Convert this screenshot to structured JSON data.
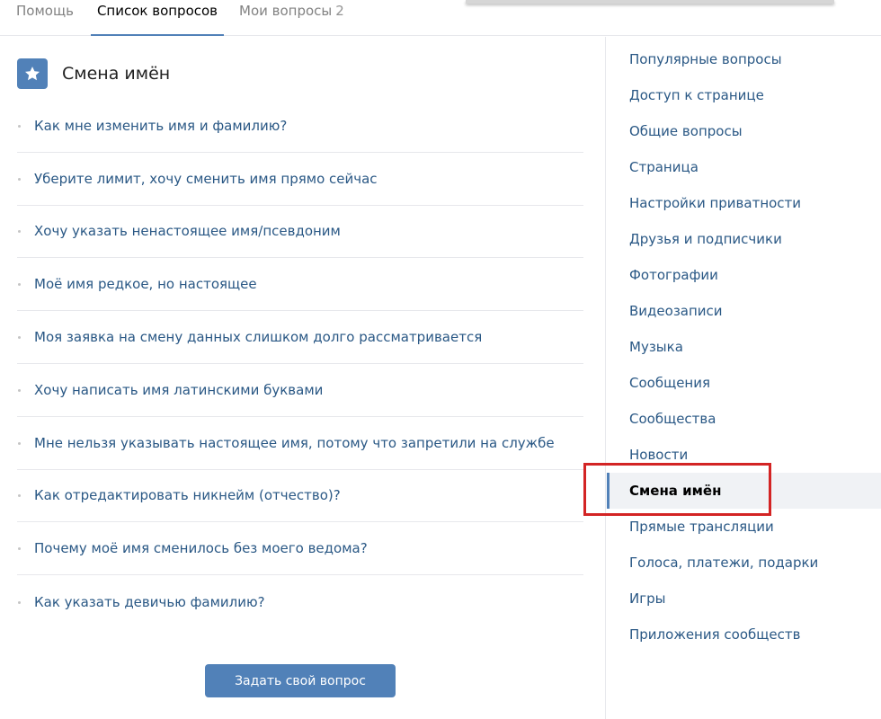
{
  "tabs": {
    "help": "Помощь",
    "questions_list": "Список вопросов",
    "my_questions": "Мои вопросы",
    "my_questions_count": "2"
  },
  "section": {
    "icon": "star-icon",
    "title": "Смена имён"
  },
  "questions": [
    "Как мне изменить имя и фамилию?",
    "Уберите лимит, хочу сменить имя прямо сейчас",
    "Хочу указать ненастоящее имя/псевдоним",
    "Моё имя редкое, но настоящее",
    "Моя заявка на смену данных слишком долго рассматривается",
    "Хочу написать имя латинскими буквами",
    "Мне нельзя указывать настоящее имя, потому что запретили на службе",
    "Как отредактировать никнейм (отчество)?",
    "Почему моё имя сменилось без моего ведома?",
    "Как указать девичью фамилию?"
  ],
  "ask_button": "Задать свой вопрос",
  "sidebar": {
    "items": [
      "Популярные вопросы",
      "Доступ к странице",
      "Общие вопросы",
      "Страница",
      "Настройки приватности",
      "Друзья и подписчики",
      "Фотографии",
      "Видеозаписи",
      "Музыка",
      "Сообщения",
      "Сообщества",
      "Новости",
      "Смена имён",
      "Прямые трансляции",
      "Голоса, платежи, подарки",
      "Игры",
      "Приложения сообществ"
    ],
    "active_index": 12
  },
  "colors": {
    "accent": "#5181b8",
    "link": "#2a5885",
    "highlight": "#d32424"
  }
}
